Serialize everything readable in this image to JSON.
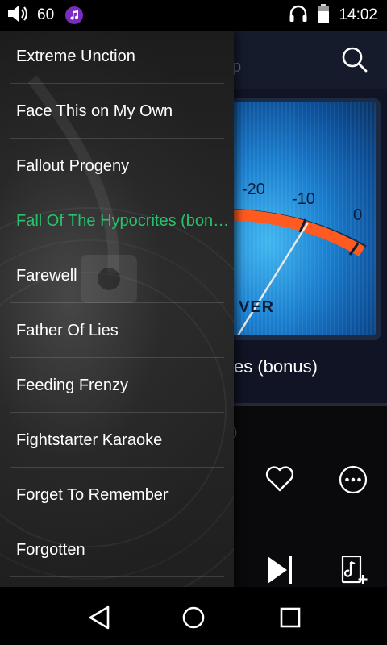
{
  "status_bar": {
    "volume_level": "60",
    "time": "14:02",
    "icons": [
      "volume-icon",
      "music-app-icon",
      "headphones-icon",
      "battery-icon"
    ]
  },
  "player": {
    "header_title_peek": "p",
    "album_art": {
      "scale_labels": [
        "-20",
        "-10",
        "0"
      ],
      "word_peek": "VER"
    },
    "track_title_peek": "es (bonus)",
    "time_peek": "0",
    "icons": [
      "search-icon",
      "heart-icon",
      "more-options-icon",
      "skip-next-icon",
      "add-to-playlist-icon"
    ]
  },
  "drawer": {
    "active_index": 3,
    "items": [
      {
        "label": "Extreme Unction"
      },
      {
        "label": "Face This on My Own"
      },
      {
        "label": "Fallout Progeny"
      },
      {
        "label": "Fall Of The Hypocrites (bonu..."
      },
      {
        "label": "Farewell"
      },
      {
        "label": "Father Of Lies"
      },
      {
        "label": "Feeding Frenzy"
      },
      {
        "label": "Fightstarter Karaoke"
      },
      {
        "label": "Forget To Remember"
      },
      {
        "label": "Forgotten"
      }
    ]
  },
  "nav_bar": {
    "icons": [
      "back-icon",
      "home-icon",
      "recents-icon"
    ]
  },
  "colors": {
    "active_item": "#26c46a",
    "music_badge": "#7b2bbd",
    "vu_needle_band": "#ff5a1f"
  }
}
